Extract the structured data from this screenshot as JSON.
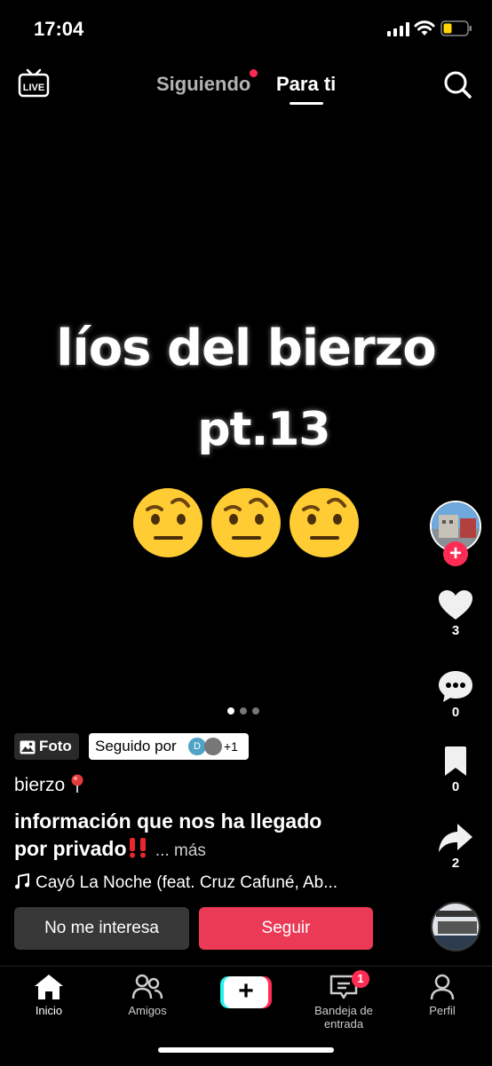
{
  "status_bar": {
    "time": "17:04"
  },
  "top_nav": {
    "tab_following": "Siguiendo",
    "tab_for_you": "Para ti",
    "live_label": "LIVE"
  },
  "post": {
    "text_line1": "líos del bierzo",
    "text_line2": "pt.13",
    "emoji": "face-with-raised-eyebrow",
    "photo_index": 1,
    "photo_count": 3,
    "type_chip": "Foto",
    "followed_by_label": "Seguido por",
    "followed_by_initial": "D",
    "followed_by_more": "+1",
    "username": "bierzo",
    "caption_line1": "información que nos ha llegado",
    "caption_line2": "por privado",
    "more_label": "... más",
    "music": "Cayó La Noche (feat. Cruz Cafuné, Ab..."
  },
  "actions": {
    "likes": "3",
    "comments": "0",
    "saves": "0",
    "shares": "2"
  },
  "buttons": {
    "not_interested": "No me interesa",
    "follow": "Seguir"
  },
  "tab_bar": {
    "home": "Inicio",
    "friends": "Amigos",
    "create": "+",
    "inbox": "Bandeja de entrada",
    "inbox_badge": "1",
    "profile": "Perfil"
  },
  "colors": {
    "accent": "#fe2c55",
    "follow_button": "#ea3a56",
    "secondary_button": "#383838",
    "cyan": "#25f4ee"
  }
}
